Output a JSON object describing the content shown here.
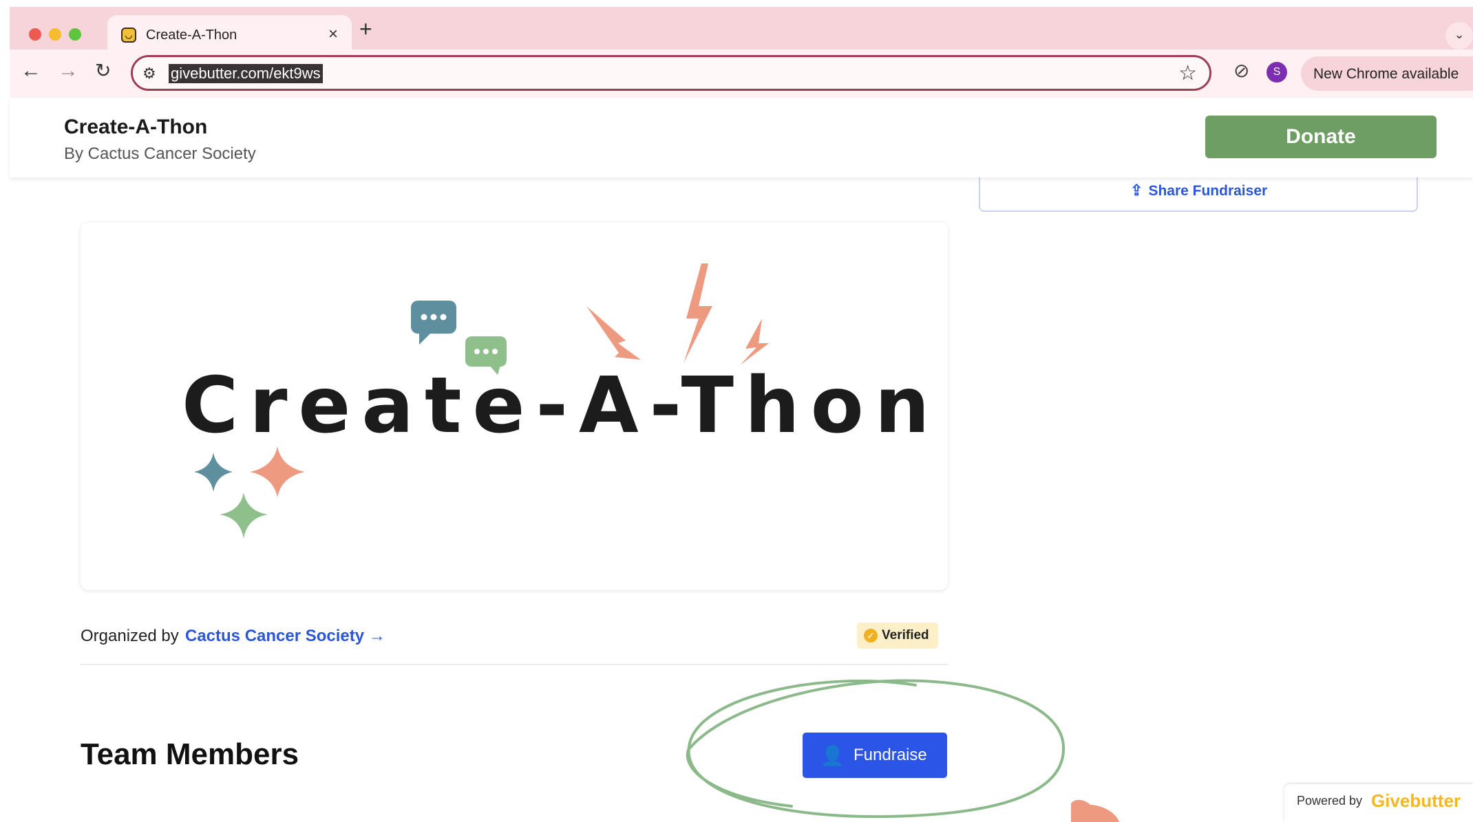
{
  "browser": {
    "tab_title": "Create-A-Thon",
    "tab_close": "×",
    "new_tab": "+",
    "tab_menu": "⌄",
    "url": "givebutter.com/ekt9ws",
    "profile_initial": "S",
    "update_label": "New Chrome available",
    "menu_glyph": "⋮"
  },
  "header": {
    "title": "Create-A-Thon",
    "byline": "By Cactus Cancer Society",
    "donate_label": "Donate"
  },
  "share": {
    "label": "Share Fundraiser"
  },
  "hero": {
    "logo_text": "Create-A-Thon",
    "colors": {
      "teal": "#5e8f9e",
      "green": "#8fbf8a",
      "salmon": "#ee9a80",
      "text": "#1c1c1c"
    }
  },
  "organizer": {
    "prefix": "Organized by",
    "name": "Cactus Cancer Society →",
    "verified_label": "Verified"
  },
  "team": {
    "heading": "Team Members",
    "fundraise_label": "Fundraise"
  },
  "footer": {
    "powered_prefix": "Powered by",
    "powered_brand": "Givebutter"
  },
  "colors": {
    "chrome_bg": "#f6d4da",
    "donate_green": "#6e9e64",
    "primary_blue": "#2a55e6",
    "link_blue": "#2b56d9",
    "annotation_green": "#8bb98a",
    "cursor_salmon": "#ee9a80"
  }
}
